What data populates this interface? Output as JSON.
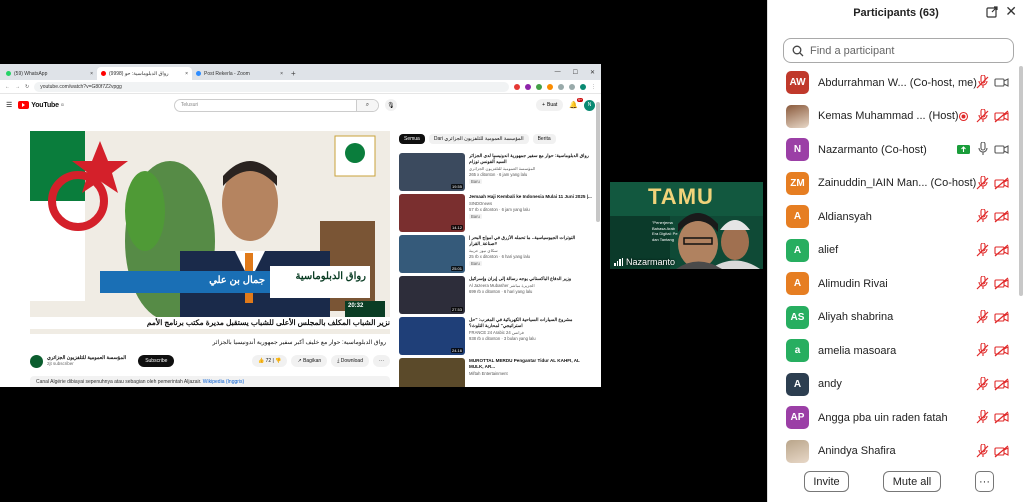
{
  "browser": {
    "tabs": [
      {
        "label": "(59) WhatsApp",
        "color": "#25d366"
      },
      {
        "label": "رواق الدبلوماسية: حو (9998)",
        "color": "#ff0000"
      },
      {
        "label": "Post Rekerla - Zoom",
        "color": "#2d8cff"
      }
    ],
    "url": "youtube.com/watch?v=G80f7Z2vpgg"
  },
  "youtube": {
    "logo": "YouTube",
    "logo_sup": "ID",
    "search_placeholder": "Telusuri",
    "create_label": "Buat",
    "notif_count": "9+",
    "avatar_letter": "N",
    "video": {
      "ticker": "نزير الشباب المكلف بالمجلس الأعلى للشباب يستقبل مديرة مكتب برنامج الأمم",
      "lower_third_show": "رواق الدبلوماسية",
      "lower_third_name": "جمال بن علي",
      "clock": "20:32",
      "title": "رواق الدبلوماسية: حوار مع خليف أكبر سفير جمهورية أندونيسيا بالجزائر",
      "channel": "المؤسسة العمومية للتلفزيون الجزائري",
      "subs": "2jt subscriber",
      "subscribe": "Subscribe",
      "likes": "72",
      "share": "Bagikan",
      "download": "Download",
      "description": "Canal Algérie dibiayai sepenuhnya atau sebagian oleh pemerintah Aljazair.",
      "description_link": "Wikipedia (Inggris)"
    },
    "chips": [
      "Semua",
      "Dari المؤسسة العمومية للتلفزيون الجزائري",
      "Berita"
    ],
    "sidebar": [
      {
        "title": "رواق الدبلوماسية: حوار مع سفير جمهورية أندونيسيا لدى الجزائر السيد ألفونس توزام",
        "channel": "المؤسسة العمومية للتلفزيون الجزائري",
        "stats": "265 x ditonton · 6 jam yang lalu",
        "badge": "Baru",
        "duration": "19.55",
        "color": "#3b4a5e"
      },
      {
        "title": "Jemaah Haji Kembali ke Indonesia Mulai 11 Juni 2025 |...",
        "channel": "SINDOnews",
        "stats": "57 rb x ditonton · 6 jam yang lalu",
        "badge": "Baru",
        "duration": "14.12",
        "color": "#7a2f2f"
      },
      {
        "title": "التوترات الجيوسياسية.. ما تحمله الأزرق في أمواج البحر | #صناعة_القرار",
        "channel": "سكاي نيوز عربية",
        "stats": "25 rb x ditonton · 6 hari yang lalu",
        "badge": "Baru",
        "duration": "25.01",
        "color": "#355a7a"
      },
      {
        "title": "وزير الدفاع الباكستاني يوجه رسالة إلى إيران وإسرائيل",
        "channel": "Al Jazeera Mubasher الجزيرة مباشر",
        "stats": "699 rb x ditonton · 6 hari yang lalu",
        "badge": "",
        "duration": "27.53",
        "color": "#2d2d3a"
      },
      {
        "title": "مشروع السيارات السياحية الكهربائية في المغرب: \"حل استراتيجي\" لمحاربة التلوث؟",
        "channel": "FRANCE 24 Arabic فرانس 24",
        "stats": "938 rb x ditonton · 3 bulan yang lalu",
        "badge": "",
        "duration": "24.16",
        "color": "#1f3f78"
      },
      {
        "title": "MUROTTAL MERDU Pengantar Tidur AL KAHFI, AL MULK, AR...",
        "channel": "Miftah Entertainment",
        "stats": "",
        "badge": "",
        "duration": "",
        "color": "#5b4a2a"
      }
    ]
  },
  "camera": {
    "name": "Nazarmanto",
    "banner_title": "TAMU",
    "banner_line1": "\"Penerjema",
    "banner_line2": "Bahasa Arab",
    "banner_line3": "Era Digital: Pe",
    "banner_line4": "dan Tantang"
  },
  "participants": {
    "header": "Participants (63)",
    "search_placeholder": "Find a participant",
    "list": [
      {
        "initials": "AW",
        "name": "Abdurrahman W... (Co-host, me)",
        "color": "#c0392b",
        "photo": false,
        "share": false,
        "mic": "muted",
        "video": "on"
      },
      {
        "initials": "",
        "name": "Kemas Muhammad ... (Host)",
        "color": "#8a5a3c",
        "photo": true,
        "share": "record",
        "mic": "muted",
        "video": "off"
      },
      {
        "initials": "N",
        "name": "Nazarmanto (Co-host)",
        "color": "#9b3fa6",
        "photo": false,
        "share": "screen",
        "mic": "on",
        "video": "on"
      },
      {
        "initials": "ZM",
        "name": "Zainuddin_IAIN Man... (Co-host)",
        "color": "#e67e22",
        "photo": false,
        "share": false,
        "mic": "muted",
        "video": "off"
      },
      {
        "initials": "A",
        "name": "Aldiansyah",
        "color": "#e67e22",
        "photo": false,
        "share": false,
        "mic": "muted",
        "video": "off"
      },
      {
        "initials": "A",
        "name": "alief",
        "color": "#27ae60",
        "photo": false,
        "share": false,
        "mic": "muted",
        "video": "off"
      },
      {
        "initials": "A",
        "name": "Alimudin Rivai",
        "color": "#e67e22",
        "photo": false,
        "share": false,
        "mic": "muted",
        "video": "off"
      },
      {
        "initials": "AS",
        "name": "Aliyah shabrina",
        "color": "#27ae60",
        "photo": false,
        "share": false,
        "mic": "muted",
        "video": "off"
      },
      {
        "initials": "a",
        "name": "amelia masoara",
        "color": "#27ae60",
        "photo": false,
        "share": false,
        "mic": "muted",
        "video": "off"
      },
      {
        "initials": "A",
        "name": "andy",
        "color": "#2c3e50",
        "photo": false,
        "share": false,
        "mic": "muted",
        "video": "off"
      },
      {
        "initials": "AP",
        "name": "Angga pba uin raden fatah",
        "color": "#9b3fa6",
        "photo": false,
        "share": false,
        "mic": "muted",
        "video": "off"
      },
      {
        "initials": "",
        "name": "Anindya Shafira",
        "color": "#b9a58a",
        "photo": true,
        "share": false,
        "mic": "muted",
        "video": "off"
      }
    ],
    "invite": "Invite",
    "mute_all": "Mute all",
    "more": "···"
  }
}
